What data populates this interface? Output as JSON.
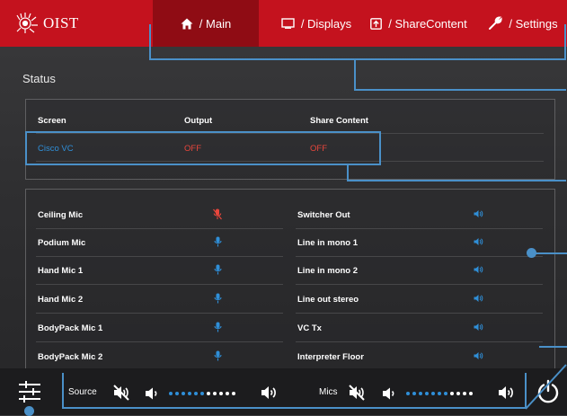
{
  "brand": {
    "logo_text": "OIST"
  },
  "nav": {
    "tabs": [
      {
        "label": "/ Main",
        "icon": "home-icon",
        "active": true
      },
      {
        "label": "/ Displays",
        "icon": "display-icon",
        "active": false
      },
      {
        "label": "/ ShareContent",
        "icon": "share-icon",
        "active": false
      },
      {
        "label": "/ Settings",
        "icon": "wrench-icon",
        "active": false
      }
    ]
  },
  "status": {
    "title": "Status",
    "headers": {
      "screen": "Screen",
      "output": "Output",
      "share": "Share Content"
    },
    "row": {
      "screen": "Cisco VC",
      "output": "OFF",
      "share": "OFF"
    }
  },
  "audio": {
    "left": [
      {
        "name": "Ceiling Mic",
        "icon": "mic-muted-icon"
      },
      {
        "name": "Podium Mic",
        "icon": "mic-icon"
      },
      {
        "name": "Hand Mic 1",
        "icon": "mic-icon"
      },
      {
        "name": "Hand Mic 2",
        "icon": "mic-icon"
      },
      {
        "name": "BodyPack Mic 1",
        "icon": "mic-icon"
      },
      {
        "name": "BodyPack Mic 2",
        "icon": "mic-icon"
      }
    ],
    "right": [
      {
        "name": "Switcher Out",
        "icon": "speaker-icon"
      },
      {
        "name": "Line in mono 1",
        "icon": "speaker-icon"
      },
      {
        "name": "Line in mono 2",
        "icon": "speaker-icon"
      },
      {
        "name": "Line out stereo",
        "icon": "speaker-icon"
      },
      {
        "name": "VC Tx",
        "icon": "speaker-icon"
      },
      {
        "name": "Interpreter Floor",
        "icon": "speaker-icon"
      }
    ]
  },
  "bottom": {
    "source_label": "Source",
    "mics_label": "Mics",
    "source_level": 0.55,
    "mics_level": 0.6
  },
  "colors": {
    "brand_red": "#c4121e",
    "active_tab": "#8f0c14",
    "accent_blue": "#2f8fd8",
    "alert_red": "#e8463c",
    "annotation_blue": "#4a90c8"
  }
}
